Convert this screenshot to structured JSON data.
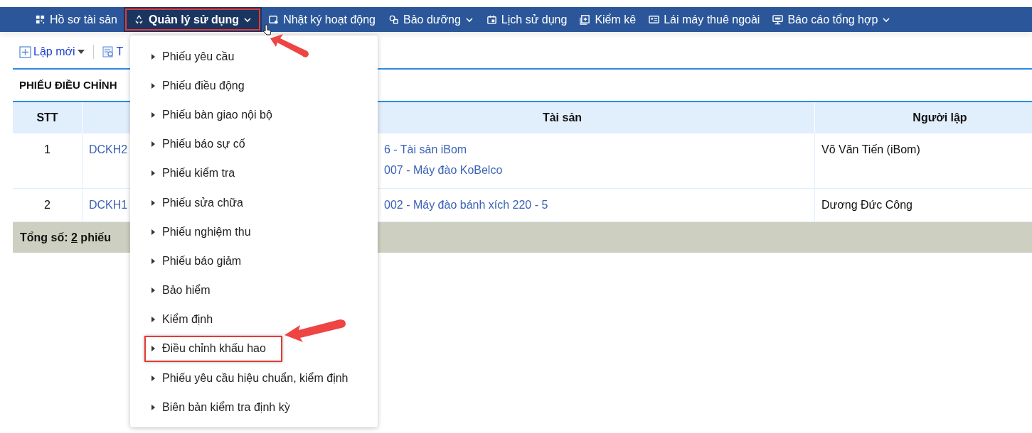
{
  "nav": [
    {
      "label": "Hồ sơ tài sản",
      "selected": false,
      "highlighted": false,
      "has_caret": false
    },
    {
      "label": "Quản lý sử dụng",
      "selected": true,
      "highlighted": true,
      "has_caret": true
    },
    {
      "label": "Nhật ký hoạt động",
      "selected": false,
      "highlighted": false,
      "has_caret": false
    },
    {
      "label": "Bảo dưỡng",
      "selected": false,
      "highlighted": false,
      "has_caret": true
    },
    {
      "label": "Lịch sử dụng",
      "selected": false,
      "highlighted": false,
      "has_caret": false
    },
    {
      "label": "Kiểm kê",
      "selected": false,
      "highlighted": false,
      "has_caret": false
    },
    {
      "label": "Lái máy thuê ngoài",
      "selected": false,
      "highlighted": false,
      "has_caret": false
    },
    {
      "label": "Báo cáo tổng hợp",
      "selected": false,
      "highlighted": false,
      "has_caret": true
    }
  ],
  "toolbar": [
    {
      "label": "Lập mới",
      "kind": "new"
    },
    {
      "label": "T",
      "kind": "search"
    }
  ],
  "title": "PHIẾU ĐIỀU CHỈNH",
  "table": {
    "columns": [
      "STT",
      "",
      "Tài sản",
      "Người lập"
    ],
    "rows": [
      {
        "stt": "1",
        "code": "DCKH2",
        "assets": [
          "6 - Tài sản iBom",
          "007 - Máy đào KoBelco"
        ],
        "creator": "Võ Văn Tiến (iBom)"
      },
      {
        "stt": "2",
        "code": "DCKH1",
        "assets": [
          "002 - Máy đào bánh xích 220 - 5"
        ],
        "creator": "Dương Đức Công"
      }
    ],
    "total": {
      "label": "Tổng số:",
      "count": "2",
      "unit": "phiếu"
    }
  },
  "menu": [
    {
      "label": "Phiếu yêu cầu",
      "highlighted": false
    },
    {
      "label": "Phiếu điều động",
      "highlighted": false
    },
    {
      "label": "Phiếu bàn giao nội bộ",
      "highlighted": false
    },
    {
      "label": "Phiếu báo sự cố",
      "highlighted": false
    },
    {
      "label": "Phiếu kiểm tra",
      "highlighted": false
    },
    {
      "label": "Phiếu sửa chữa",
      "highlighted": false
    },
    {
      "label": "Phiếu nghiệm thu",
      "highlighted": false
    },
    {
      "label": "Phiếu báo giảm",
      "highlighted": false
    },
    {
      "label": "Bảo hiểm",
      "highlighted": false
    },
    {
      "label": "Kiểm định",
      "highlighted": false
    },
    {
      "label": "Điều chỉnh khấu hao",
      "highlighted": true
    },
    {
      "label": "Phiếu yêu cầu hiệu chuẩn, kiểm định",
      "highlighted": false
    },
    {
      "label": "Biên bản kiểm tra định kỳ",
      "highlighted": false
    }
  ]
}
